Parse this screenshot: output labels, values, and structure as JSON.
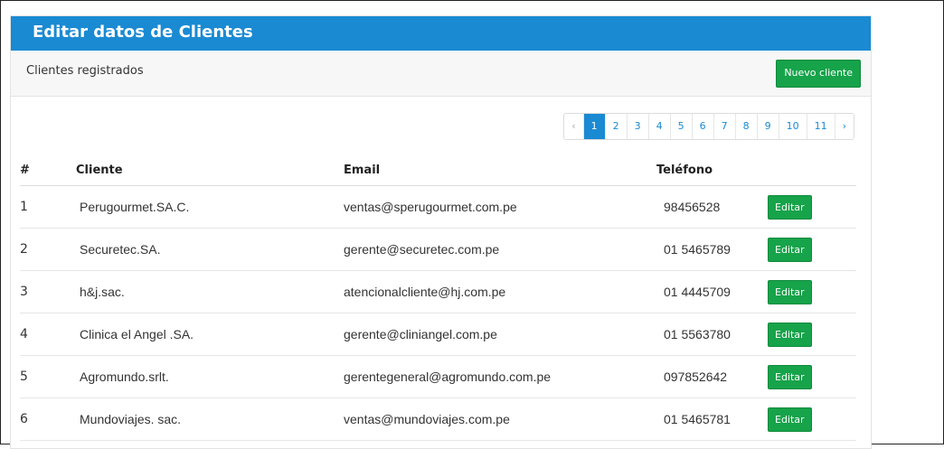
{
  "header": {
    "title": "Editar datos de Clientes"
  },
  "subheader": {
    "label": "Clientes registrados",
    "new_button": "Nuevo cliente"
  },
  "pagination": {
    "prev": "‹",
    "next": "›",
    "pages": [
      "1",
      "2",
      "3",
      "4",
      "5",
      "6",
      "7",
      "8",
      "9",
      "10",
      "11"
    ],
    "active_page": "1"
  },
  "table": {
    "columns": [
      "#",
      "Cliente",
      "Email",
      "Teléfono"
    ],
    "edit_label": "Editar",
    "rows": [
      {
        "num": "1",
        "cliente": "Perugourmet.SA.C.",
        "email": "ventas@sperugourmet.com.pe",
        "telefono": "98456528"
      },
      {
        "num": "2",
        "cliente": "Securetec.SA.",
        "email": "gerente@securetec.com.pe",
        "telefono": "01 5465789"
      },
      {
        "num": "3",
        "cliente": "h&j.sac.",
        "email": "atencionalcliente@hj.com.pe",
        "telefono": "01 4445709"
      },
      {
        "num": "4",
        "cliente": "Clinica el Angel .SA.",
        "email": "gerente@cliniangel.com.pe",
        "telefono": "01 5563780"
      },
      {
        "num": "5",
        "cliente": "Agromundo.srlt.",
        "email": "gerentegeneral@agromundo.com.pe",
        "telefono": "097852642"
      },
      {
        "num": "6",
        "cliente": "Mundoviajes. sac.",
        "email": "ventas@mundoviajes.com.pe",
        "telefono": "01 5465781"
      }
    ]
  },
  "colors": {
    "header_bg": "#1a8ad3",
    "button_green": "#16a34a",
    "active_page": "#1a8ad3"
  }
}
